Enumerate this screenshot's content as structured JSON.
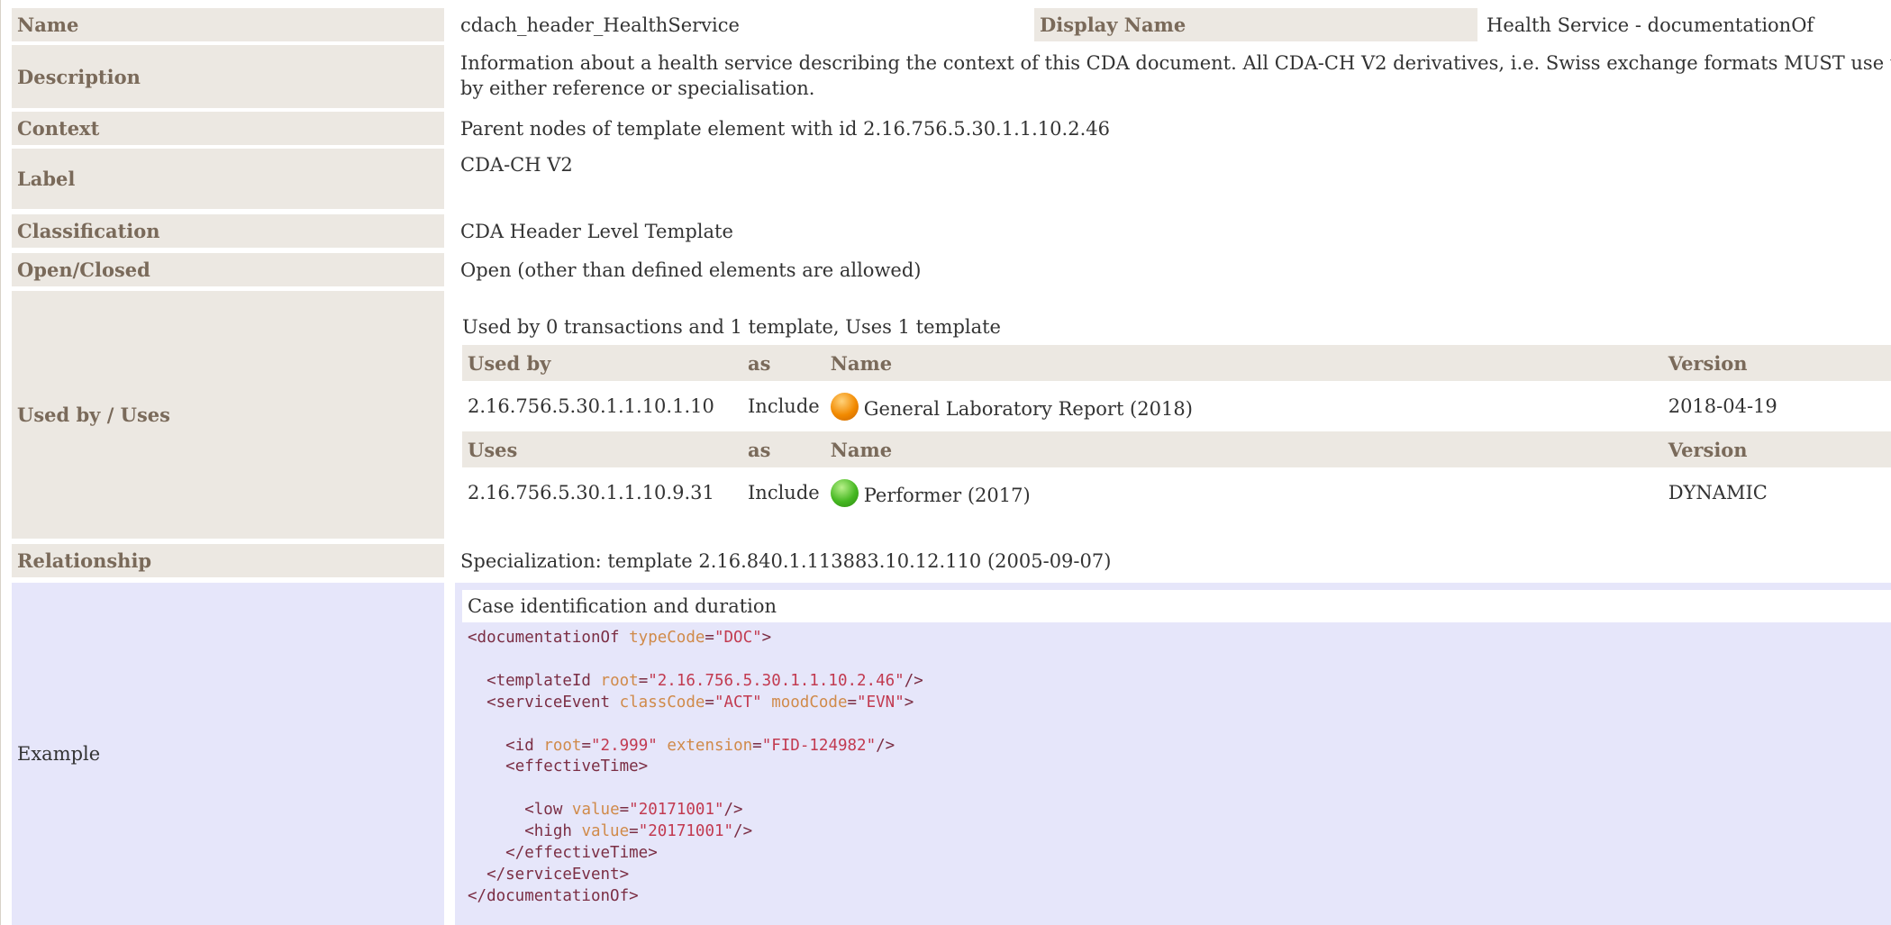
{
  "name": {
    "label": "Name",
    "value": "cdach_header_HealthService"
  },
  "display_name": {
    "label": "Display Name",
    "value": "Health Service - documentationOf"
  },
  "description": {
    "label": "Description",
    "line1": "Information about a health service describing the context of this CDA document. All CDA-CH V2 derivatives, i.e. Swiss exchange formats MUST use this templa",
    "line2": "by either reference or specialisation."
  },
  "context": {
    "label": "Context",
    "value": "Parent nodes of template element with id 2.16.756.5.30.1.1.10.2.46"
  },
  "label_row": {
    "label": "Label",
    "value": "CDA-CH V2"
  },
  "classification": {
    "label": "Classification",
    "value": "CDA Header Level Template"
  },
  "open_closed": {
    "label": "Open/Closed",
    "value": "Open (other than defined elements are allowed)"
  },
  "used_by_uses": {
    "label": "Used by / Uses",
    "summary": "Used by 0 transactions and 1 template, Uses 1 template",
    "used_by_header": {
      "col1": "Used by",
      "col2": "as",
      "col3": "Name",
      "col4": "Version"
    },
    "used_by": [
      {
        "id": "2.16.756.5.30.1.1.10.1.10",
        "as": "Include",
        "status_icon": "orange-status-icon",
        "name": "General Laboratory Report (2018)",
        "version": "2018-04-19"
      }
    ],
    "uses_header": {
      "col1": "Uses",
      "col2": "as",
      "col3": "Name",
      "col4": "Version"
    },
    "uses": [
      {
        "id": "2.16.756.5.30.1.1.10.9.31",
        "as": "Include",
        "status_icon": "green-status-icon",
        "name": "Performer (2017)",
        "version": "DYNAMIC"
      }
    ]
  },
  "relationship": {
    "label": "Relationship",
    "value": "Specialization: template 2.16.840.1.113883.10.12.110 (2005-09-07)"
  },
  "example": {
    "label": "Example",
    "title": "Case identification and duration",
    "code": {
      "l1_tag": "<documentationOf",
      "l1_attr": "typeCode",
      "l1_val": "\"DOC\"",
      "l1_end": ">",
      "l2_tag": "<templateId",
      "l2_attr": "root",
      "l2_val": "\"2.16.756.5.30.1.1.10.2.46\"",
      "l2_end": "/>",
      "l3_tag": "<serviceEvent",
      "l3_attr1": "classCode",
      "l3_val1": "\"ACT\"",
      "l3_attr2": "moodCode",
      "l3_val2": "\"EVN\"",
      "l3_end": ">",
      "l4_tag": "<id",
      "l4_attr1": "root",
      "l4_val1": "\"2.999\"",
      "l4_attr2": "extension",
      "l4_val2": "\"FID-124982\"",
      "l4_end": "/>",
      "l5_tag": "<effectiveTime>",
      "l6_tag": "<low",
      "l6_attr": "value",
      "l6_val": "\"20171001\"",
      "l6_end": "/>",
      "l7_tag": "<high",
      "l7_attr": "value",
      "l7_val": "\"20171001\"",
      "l7_end": "/>",
      "l8_tag": "</effectiveTime>",
      "l9_tag": "</serviceEvent>",
      "l10_tag": "</documentationOf>"
    }
  },
  "colors": {
    "label_bg": "#ece8e2",
    "label_text": "#7a6a5a",
    "example_bg": "#e6e6fa",
    "code_tag": "#7b2e44",
    "code_attr": "#d08a4a",
    "code_value": "#c23a50"
  }
}
